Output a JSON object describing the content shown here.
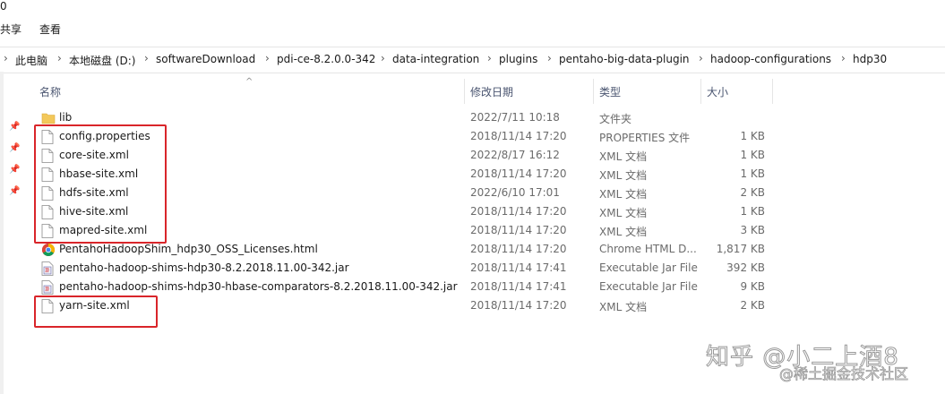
{
  "window": {
    "title_fragment": "0"
  },
  "menu": {
    "share": "共享",
    "view": "查看"
  },
  "breadcrumb": [
    "此电脑",
    "本地磁盘 (D:)",
    "softwareDownload",
    "pdi-ce-8.2.0.0-342",
    "data-integration",
    "plugins",
    "pentaho-big-data-plugin",
    "hadoop-configurations",
    "hdp30"
  ],
  "columns": {
    "name": "名称",
    "modified": "修改日期",
    "type": "类型",
    "size": "大小"
  },
  "files": [
    {
      "icon": "folder-icon",
      "name": "lib",
      "modified": "2022/7/11 10:18",
      "type": "文件夹",
      "size": ""
    },
    {
      "icon": "file-icon",
      "name": "config.properties",
      "modified": "2018/11/14 17:20",
      "type": "PROPERTIES 文件",
      "size": "1 KB"
    },
    {
      "icon": "file-icon",
      "name": "core-site.xml",
      "modified": "2022/8/17 16:12",
      "type": "XML 文档",
      "size": "1 KB"
    },
    {
      "icon": "file-icon",
      "name": "hbase-site.xml",
      "modified": "2018/11/14 17:20",
      "type": "XML 文档",
      "size": "1 KB"
    },
    {
      "icon": "file-icon",
      "name": "hdfs-site.xml",
      "modified": "2022/6/10 17:01",
      "type": "XML 文档",
      "size": "2 KB"
    },
    {
      "icon": "file-icon",
      "name": "hive-site.xml",
      "modified": "2018/11/14 17:20",
      "type": "XML 文档",
      "size": "1 KB"
    },
    {
      "icon": "file-icon",
      "name": "mapred-site.xml",
      "modified": "2018/11/14 17:20",
      "type": "XML 文档",
      "size": "3 KB"
    },
    {
      "icon": "chrome-icon",
      "name": "PentahoHadoopShim_hdp30_OSS_Licenses.html",
      "modified": "2018/11/14 17:20",
      "type": "Chrome HTML D...",
      "size": "1,817 KB"
    },
    {
      "icon": "jar-icon",
      "name": "pentaho-hadoop-shims-hdp30-8.2.2018.11.00-342.jar",
      "modified": "2018/11/14 17:41",
      "type": "Executable Jar File",
      "size": "392 KB"
    },
    {
      "icon": "jar-icon",
      "name": "pentaho-hadoop-shims-hdp30-hbase-comparators-8.2.2018.11.00-342.jar",
      "modified": "2018/11/14 17:41",
      "type": "Executable Jar File",
      "size": "9 KB"
    },
    {
      "icon": "file-icon",
      "name": "yarn-site.xml",
      "modified": "2018/11/14 17:20",
      "type": "XML 文档",
      "size": "2 KB"
    }
  ],
  "watermark": {
    "zhihu": "知乎 @小二上酒8",
    "juejin": "@稀土掘金技术社区"
  },
  "colors": {
    "highlight": "#d9252a",
    "folder": "#f3c85a"
  }
}
